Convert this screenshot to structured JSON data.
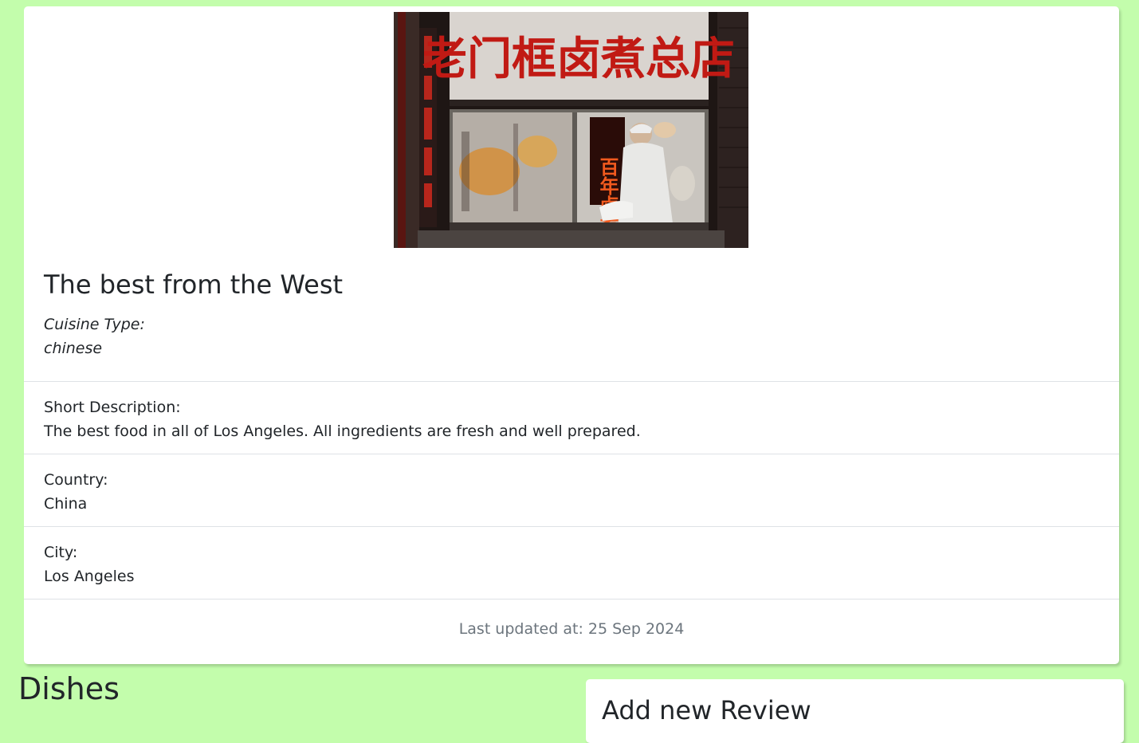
{
  "restaurant": {
    "image_alt": "Restaurant window with chef at work",
    "sign_text": "老门框卤煮总店",
    "window_text": "百年卤煮",
    "name": "The best from the West",
    "cuisine_label": "Cuisine Type:",
    "cuisine_value": "chinese",
    "description_label": "Short Description:",
    "description_value": "The best food in all of Los Angeles. All ingredients are fresh and well prepared.",
    "country_label": "Country:",
    "country_value": "China",
    "city_label": "City:",
    "city_value": "Los Angeles",
    "last_updated": "Last updated at: 25 Sep 2024"
  },
  "dishes": {
    "heading": "Dishes"
  },
  "review": {
    "heading": "Add new Review"
  },
  "colors": {
    "page_background": "#c3fdac",
    "card_background": "#ffffff",
    "muted_text": "#6c757d",
    "divider": "#dee2e6"
  }
}
